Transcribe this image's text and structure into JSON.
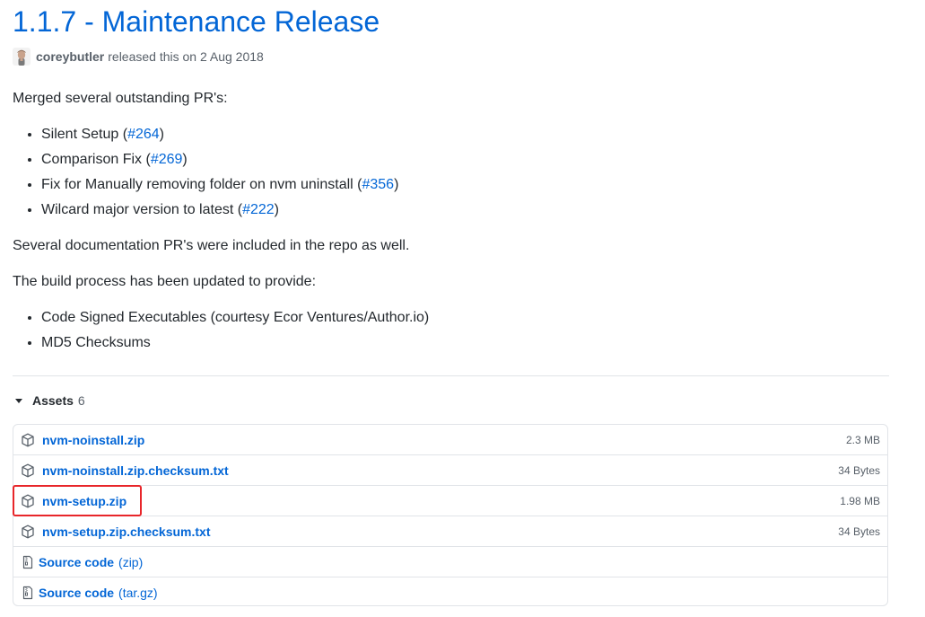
{
  "release": {
    "title": "1.1.7 - Maintenance Release",
    "author": "coreybutler",
    "released_text": "released this on 2 Aug 2018"
  },
  "notes": {
    "intro": "Merged several outstanding PR's:",
    "prs": [
      {
        "text": "Silent Setup (",
        "link": "#264",
        "suffix": ")"
      },
      {
        "text": "Comparison Fix (",
        "link": "#269",
        "suffix": ")"
      },
      {
        "text": "Fix for Manually removing folder on nvm uninstall (",
        "link": "#356",
        "suffix": ")"
      },
      {
        "text": "Wilcard major version to latest (",
        "link": "#222",
        "suffix": ")"
      }
    ],
    "docs_note": "Several documentation PR's were included in the repo as well.",
    "build_intro": "The build process has been updated to provide:",
    "build_items": [
      "Code Signed Executables (courtesy Ecor Ventures/Author.io)",
      "MD5 Checksums"
    ]
  },
  "assets": {
    "label": "Assets",
    "count": "6",
    "files": [
      {
        "name": "nvm-noinstall.zip",
        "size": "2.3 MB",
        "icon": "package-icon"
      },
      {
        "name": "nvm-noinstall.zip.checksum.txt",
        "size": "34 Bytes",
        "icon": "package-icon"
      },
      {
        "name": "nvm-setup.zip",
        "size": "1.98 MB",
        "icon": "package-icon"
      },
      {
        "name": "nvm-setup.zip.checksum.txt",
        "size": "34 Bytes",
        "icon": "package-icon"
      }
    ],
    "sources": [
      {
        "label": "Source code",
        "ext": "(zip)",
        "icon": "file-zip-icon"
      },
      {
        "label": "Source code",
        "ext": "(tar.gz)",
        "icon": "file-zip-icon"
      }
    ]
  },
  "colors": {
    "link": "#0366d6",
    "highlight": "#e8262a",
    "muted": "#586069"
  }
}
